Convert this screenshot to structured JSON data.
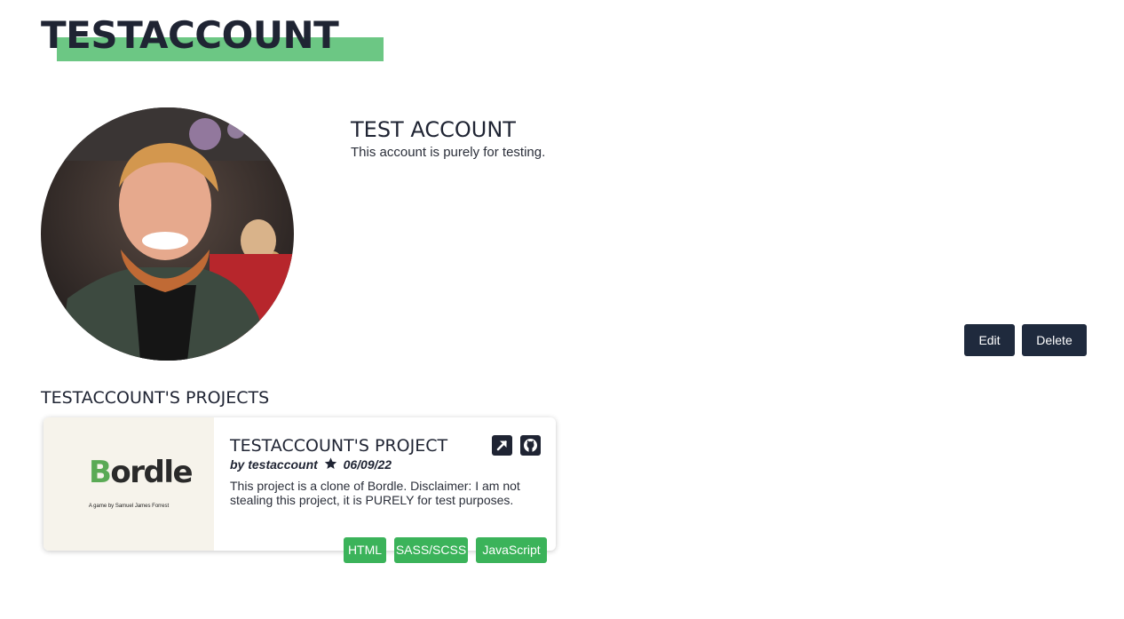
{
  "header": {
    "site_title": "TESTACCOUNT",
    "accent_color": "#6cc784"
  },
  "profile": {
    "avatar_icon": "user-photo",
    "display_name": "TEST ACCOUNT",
    "bio": "This account is purely for testing.",
    "edit_label": "Edit",
    "delete_label": "Delete",
    "button_color": "#1f2a3d"
  },
  "projects": {
    "heading": "TESTACCOUNT'S PROJECTS",
    "items": [
      {
        "title": "TESTACCOUNT'S PROJECT",
        "author": "by testaccount",
        "date": "06/09/22",
        "description": "This project is a clone of Bordle. Disclaimer: I am not stealing this project, it is PURELY for test purposes.",
        "thumbnail": {
          "logo_initial": "B",
          "logo_rest": "ordle",
          "subtitle": "A game by Samuel James Forrest"
        },
        "link_icon": "external-link-icon",
        "repo_icon": "github-icon",
        "tags": [
          "HTML",
          "SASS/SCSS",
          "JavaScript"
        ],
        "tag_color": "#3bb35a"
      }
    ]
  }
}
